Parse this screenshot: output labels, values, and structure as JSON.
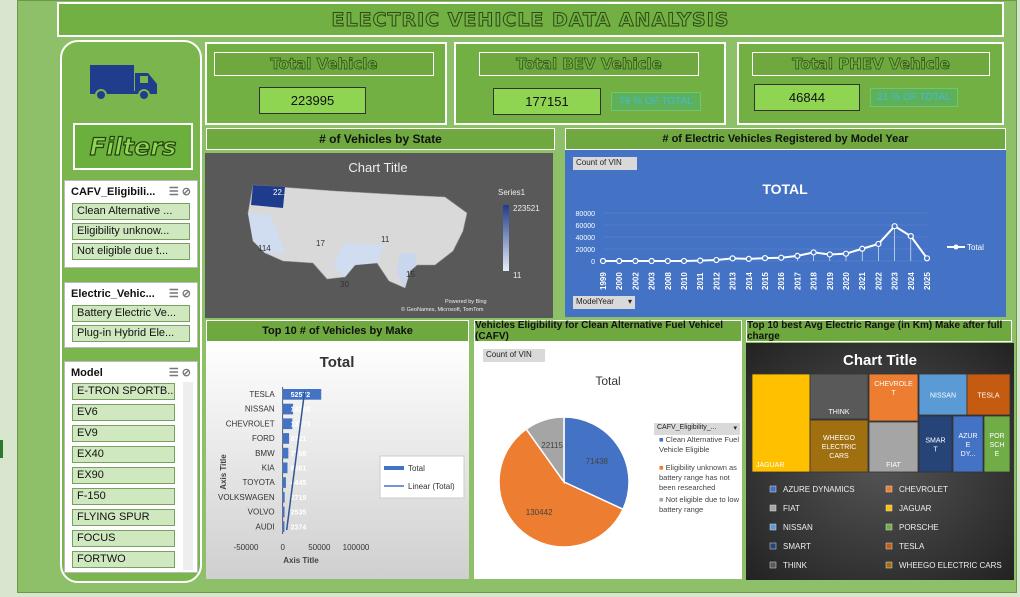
{
  "dashboard": {
    "title": "ELECTRIC VEHICLE DATA ANALYSIS",
    "filters_label": "Filters"
  },
  "kpis": {
    "total": {
      "label": "Total Vehicle",
      "value": "223995"
    },
    "bev": {
      "label": "Total BEV Vehicle",
      "value": "177151",
      "pct": "79 % OF TOTAL"
    },
    "phev": {
      "label": "Total PHEV Vehicle",
      "value": "46844",
      "pct": "21 % OF TOTAL"
    }
  },
  "slicers": {
    "cafv": {
      "title": "CAFV_Eligibili...",
      "items": [
        "Clean Alternative ...",
        "Eligibility unknow...",
        "Not eligible due t..."
      ]
    },
    "evtype": {
      "title": "Electric_Vehic...",
      "items": [
        "Battery Electric Ve...",
        "Plug-in Hybrid Ele..."
      ]
    },
    "model": {
      "title": "Model",
      "items": [
        "E-TRON SPORTB...",
        "EV6",
        "EV9",
        "EX40",
        "EX90",
        "F-150",
        "FLYING SPUR",
        "FOCUS",
        "FORTWO"
      ]
    }
  },
  "sections": {
    "state": "# of Vehicles by State",
    "year": "# of Electric Vehicles Registered by Model Year",
    "make": "Top 10 # of Vehicles by Make",
    "cafv": "Vehicles Eligibility for Clean Alternative Fuel Vehicel (CAFV)",
    "range": "Top 10 best Avg Electric Range (in Km) Make after full charge"
  },
  "map": {
    "title": "Chart Title",
    "legend_series": "Series1",
    "scale_max": "223521",
    "scale_min": "11",
    "labels": [
      "22..",
      "114",
      "17",
      "11",
      "30",
      "15"
    ],
    "credit1": "Powered by Bing",
    "credit2": "© GeoNames, Microsoft, TomTom"
  },
  "year_chart": {
    "field_button": "Count of VIN",
    "axis_button": "ModelYear",
    "title": "TOTAL",
    "legend": "Total"
  },
  "make_chart": {
    "title": "Total",
    "ylabel": "Axis Title",
    "xlabel": "Axis Title",
    "legend_total": "Total",
    "legend_linear": "Linear (Total)",
    "ticks": [
      "-50000",
      "0",
      "50000",
      "100000"
    ]
  },
  "cafv_chart": {
    "field_button": "Count of VIN",
    "title": "Total",
    "filter_button": "CAFV_Eligibility_...",
    "legend": [
      "Clean Alternative Fuel Vehicle Eligible",
      "Eligibility unknown as battery range has not been researched",
      "Not eligible due to low battery range"
    ]
  },
  "treemap": {
    "title": "Chart Title",
    "legend": [
      "AZURE DYNAMICS",
      "CHEVROLET",
      "FIAT",
      "JAGUAR",
      "NISSAN",
      "PORSCHE",
      "SMART",
      "TESLA",
      "THINK",
      "WHEEGO ELECTRIC CARS"
    ]
  },
  "chart_data": [
    {
      "type": "line",
      "title": "TOTAL",
      "x": [
        "1999",
        "2000",
        "2002",
        "2003",
        "2008",
        "2010",
        "2011",
        "2012",
        "2013",
        "2014",
        "2015",
        "2016",
        "2017",
        "2018",
        "2019",
        "2020",
        "2021",
        "2022",
        "2023",
        "2024",
        "2025"
      ],
      "series": [
        {
          "name": "Total",
          "values": [
            5,
            7,
            2,
            3,
            20,
            25,
            650,
            1600,
            4400,
            3500,
            4800,
            5500,
            8500,
            14300,
            10900,
            12200,
            20400,
            28400,
            58000,
            41500,
            4500
          ]
        }
      ],
      "ylim": [
        0,
        80000
      ],
      "yticks": [
        "80000",
        "60000",
        "40000",
        "20000",
        "0"
      ]
    },
    {
      "type": "bar",
      "title": "Total",
      "categories": [
        "TESLA",
        "NISSAN",
        "CHEVROLET",
        "FORD",
        "BMW",
        "KIA",
        "TOYOTA",
        "VOLKSWAGEN",
        "VOLVO",
        "AUDI"
      ],
      "series": [
        {
          "name": "Total",
          "values": [
            52572,
            14188,
            13173,
            8721,
            7758,
            6561,
            4445,
            2719,
            2535,
            2374
          ]
        }
      ],
      "xlim": [
        -50000,
        100000
      ]
    },
    {
      "type": "pie",
      "title": "Total",
      "categories": [
        "Clean Alternative Fuel Vehicle Eligible",
        "Eligibility unknown as battery range has not been researched",
        "Not eligible due to low battery range"
      ],
      "values": [
        71438,
        130442,
        22115
      ],
      "colors": [
        "#4472c4",
        "#ed7d31",
        "#a5a5a5"
      ]
    },
    {
      "type": "treemap",
      "title": "Chart Title",
      "categories": [
        "JAGUAR",
        "THINK",
        "WHEEGO ELECTRIC CARS",
        "CHEVROLET",
        "FIAT",
        "NISSAN",
        "SMART",
        "AZURE DYNAMICS",
        "TESLA",
        "PORSCHE"
      ]
    }
  ]
}
